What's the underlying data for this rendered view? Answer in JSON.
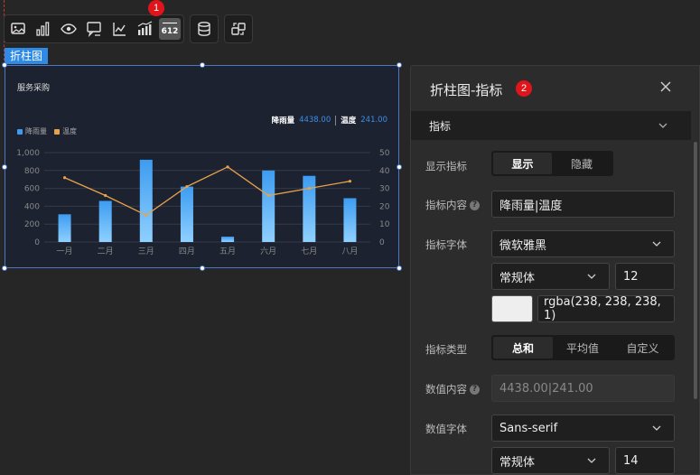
{
  "toolbar": {
    "icons": [
      "image-icon",
      "bar-chart-icon",
      "eye-icon",
      "comment-icon",
      "line-axis-icon",
      "bar-line-icon",
      "number-indicator-icon",
      "database-icon",
      "switch-icon"
    ],
    "number_glyph": "612",
    "badge1": "1"
  },
  "component_tag": "折柱图",
  "chart": {
    "title": "服务采购",
    "indicator": {
      "label1": "降雨量",
      "value1": "4438.00",
      "label2": "温度",
      "value2": "241.00"
    }
  },
  "chart_data": {
    "type": "bar",
    "categories": [
      "一月",
      "二月",
      "三月",
      "四月",
      "五月",
      "六月",
      "七月",
      "八月"
    ],
    "series": [
      {
        "name": "降雨量",
        "type": "bar",
        "axis": "left",
        "color": "#3d9cf0",
        "values": [
          310,
          460,
          920,
          620,
          60,
          800,
          740,
          490
        ]
      },
      {
        "name": "温度",
        "type": "line",
        "axis": "right",
        "color": "#e8a24a",
        "values": [
          36,
          26,
          15,
          31,
          42,
          26,
          30,
          34
        ]
      }
    ],
    "y_left": {
      "ticks": [
        "0",
        "200",
        "400",
        "600",
        "800",
        "1,000"
      ],
      "ylim": [
        0,
        1000
      ]
    },
    "y_right": {
      "ticks": [
        "0",
        "10",
        "20",
        "30",
        "40",
        "50"
      ],
      "ylim": [
        0,
        50
      ]
    },
    "legend_position": "top-left"
  },
  "panel": {
    "title": "折柱图-指标",
    "badge2": "2",
    "section": "指标",
    "show_label": "显示指标",
    "show_options": [
      "显示",
      "隐藏"
    ],
    "content_label": "指标内容",
    "content_value": "降雨量|温度",
    "font_label": "指标字体",
    "font_value": "微软雅黑",
    "weight_value": "常规体",
    "size_value": "12",
    "color_value": "rgba(238, 238, 238, 1)",
    "type_label": "指标类型",
    "type_options": [
      "总和",
      "平均值",
      "自定义"
    ],
    "num_content_label": "数值内容",
    "num_content_value": "4438.00|241.00",
    "num_font_label": "数值字体",
    "num_font_value": "Sans-serif",
    "num_weight_value": "常规体",
    "num_size_value": "14"
  },
  "colors": {
    "accent": "#2e8ae6",
    "bar": "#3d9cf0",
    "line": "#e8a24a",
    "badge": "#e0141b"
  }
}
